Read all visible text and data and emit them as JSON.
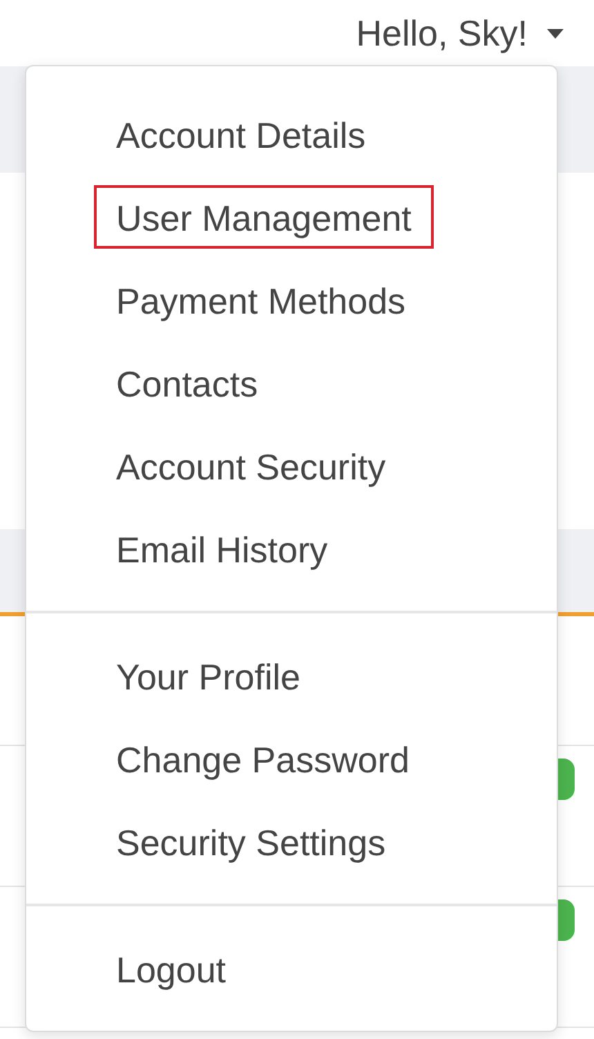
{
  "header": {
    "greeting": "Hello, Sky!"
  },
  "menu": {
    "groups": [
      {
        "items": [
          {
            "label": "Account Details",
            "highlighted": false
          },
          {
            "label": "User Management",
            "highlighted": true
          },
          {
            "label": "Payment Methods",
            "highlighted": false
          },
          {
            "label": "Contacts",
            "highlighted": false
          },
          {
            "label": "Account Security",
            "highlighted": false
          },
          {
            "label": "Email History",
            "highlighted": false
          }
        ]
      },
      {
        "items": [
          {
            "label": "Your Profile",
            "highlighted": false
          },
          {
            "label": "Change Password",
            "highlighted": false
          },
          {
            "label": "Security Settings",
            "highlighted": false
          }
        ]
      },
      {
        "items": [
          {
            "label": "Logout",
            "highlighted": false
          }
        ]
      }
    ]
  },
  "table": {
    "rows": [
      {
        "badge": false
      },
      {
        "badge": true
      },
      {
        "badge": true
      }
    ]
  }
}
